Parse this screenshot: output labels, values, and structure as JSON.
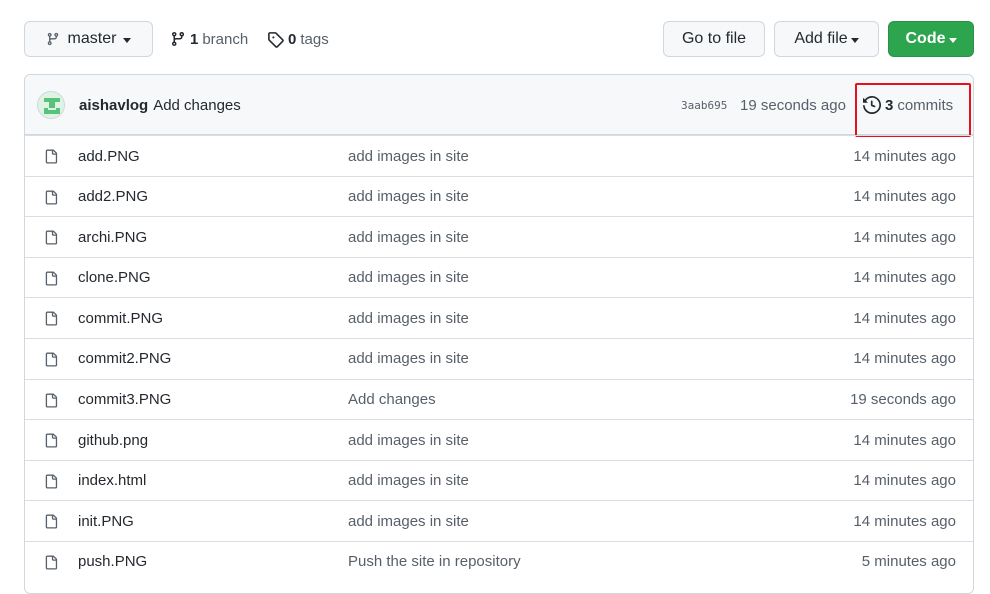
{
  "toolbar": {
    "branch_select": "master",
    "branch_count": "1",
    "branch_label": "branch",
    "tag_count": "0",
    "tag_label": "tags",
    "go_to_file": "Go to file",
    "add_file": "Add file",
    "code": "Code"
  },
  "latest_commit": {
    "author": "aishavlog",
    "message": "Add changes",
    "sha": "3aab695",
    "time": "19 seconds ago",
    "commit_count": "3",
    "commit_label": "commits"
  },
  "files": [
    {
      "name": "add.PNG",
      "message": "add images in site",
      "age": "14 minutes ago"
    },
    {
      "name": "add2.PNG",
      "message": "add images in site",
      "age": "14 minutes ago"
    },
    {
      "name": "archi.PNG",
      "message": "add images in site",
      "age": "14 minutes ago"
    },
    {
      "name": "clone.PNG",
      "message": "add images in site",
      "age": "14 minutes ago"
    },
    {
      "name": "commit.PNG",
      "message": "add images in site",
      "age": "14 minutes ago"
    },
    {
      "name": "commit2.PNG",
      "message": "add images in site",
      "age": "14 minutes ago"
    },
    {
      "name": "commit3.PNG",
      "message": "Add changes",
      "age": "19 seconds ago"
    },
    {
      "name": "github.png",
      "message": "add images in site",
      "age": "14 minutes ago"
    },
    {
      "name": "index.html",
      "message": "add images in site",
      "age": "14 minutes ago"
    },
    {
      "name": "init.PNG",
      "message": "add images in site",
      "age": "14 minutes ago"
    },
    {
      "name": "push.PNG",
      "message": "Push the site in repository",
      "age": "5 minutes ago"
    }
  ],
  "colors": {
    "primary_button": "#2da44e",
    "annotation": "#e8101e",
    "muted_text": "#57606a"
  },
  "icons": {
    "branch": "git-branch-icon",
    "tag": "tag-icon",
    "history": "history-icon",
    "file": "file-icon"
  }
}
